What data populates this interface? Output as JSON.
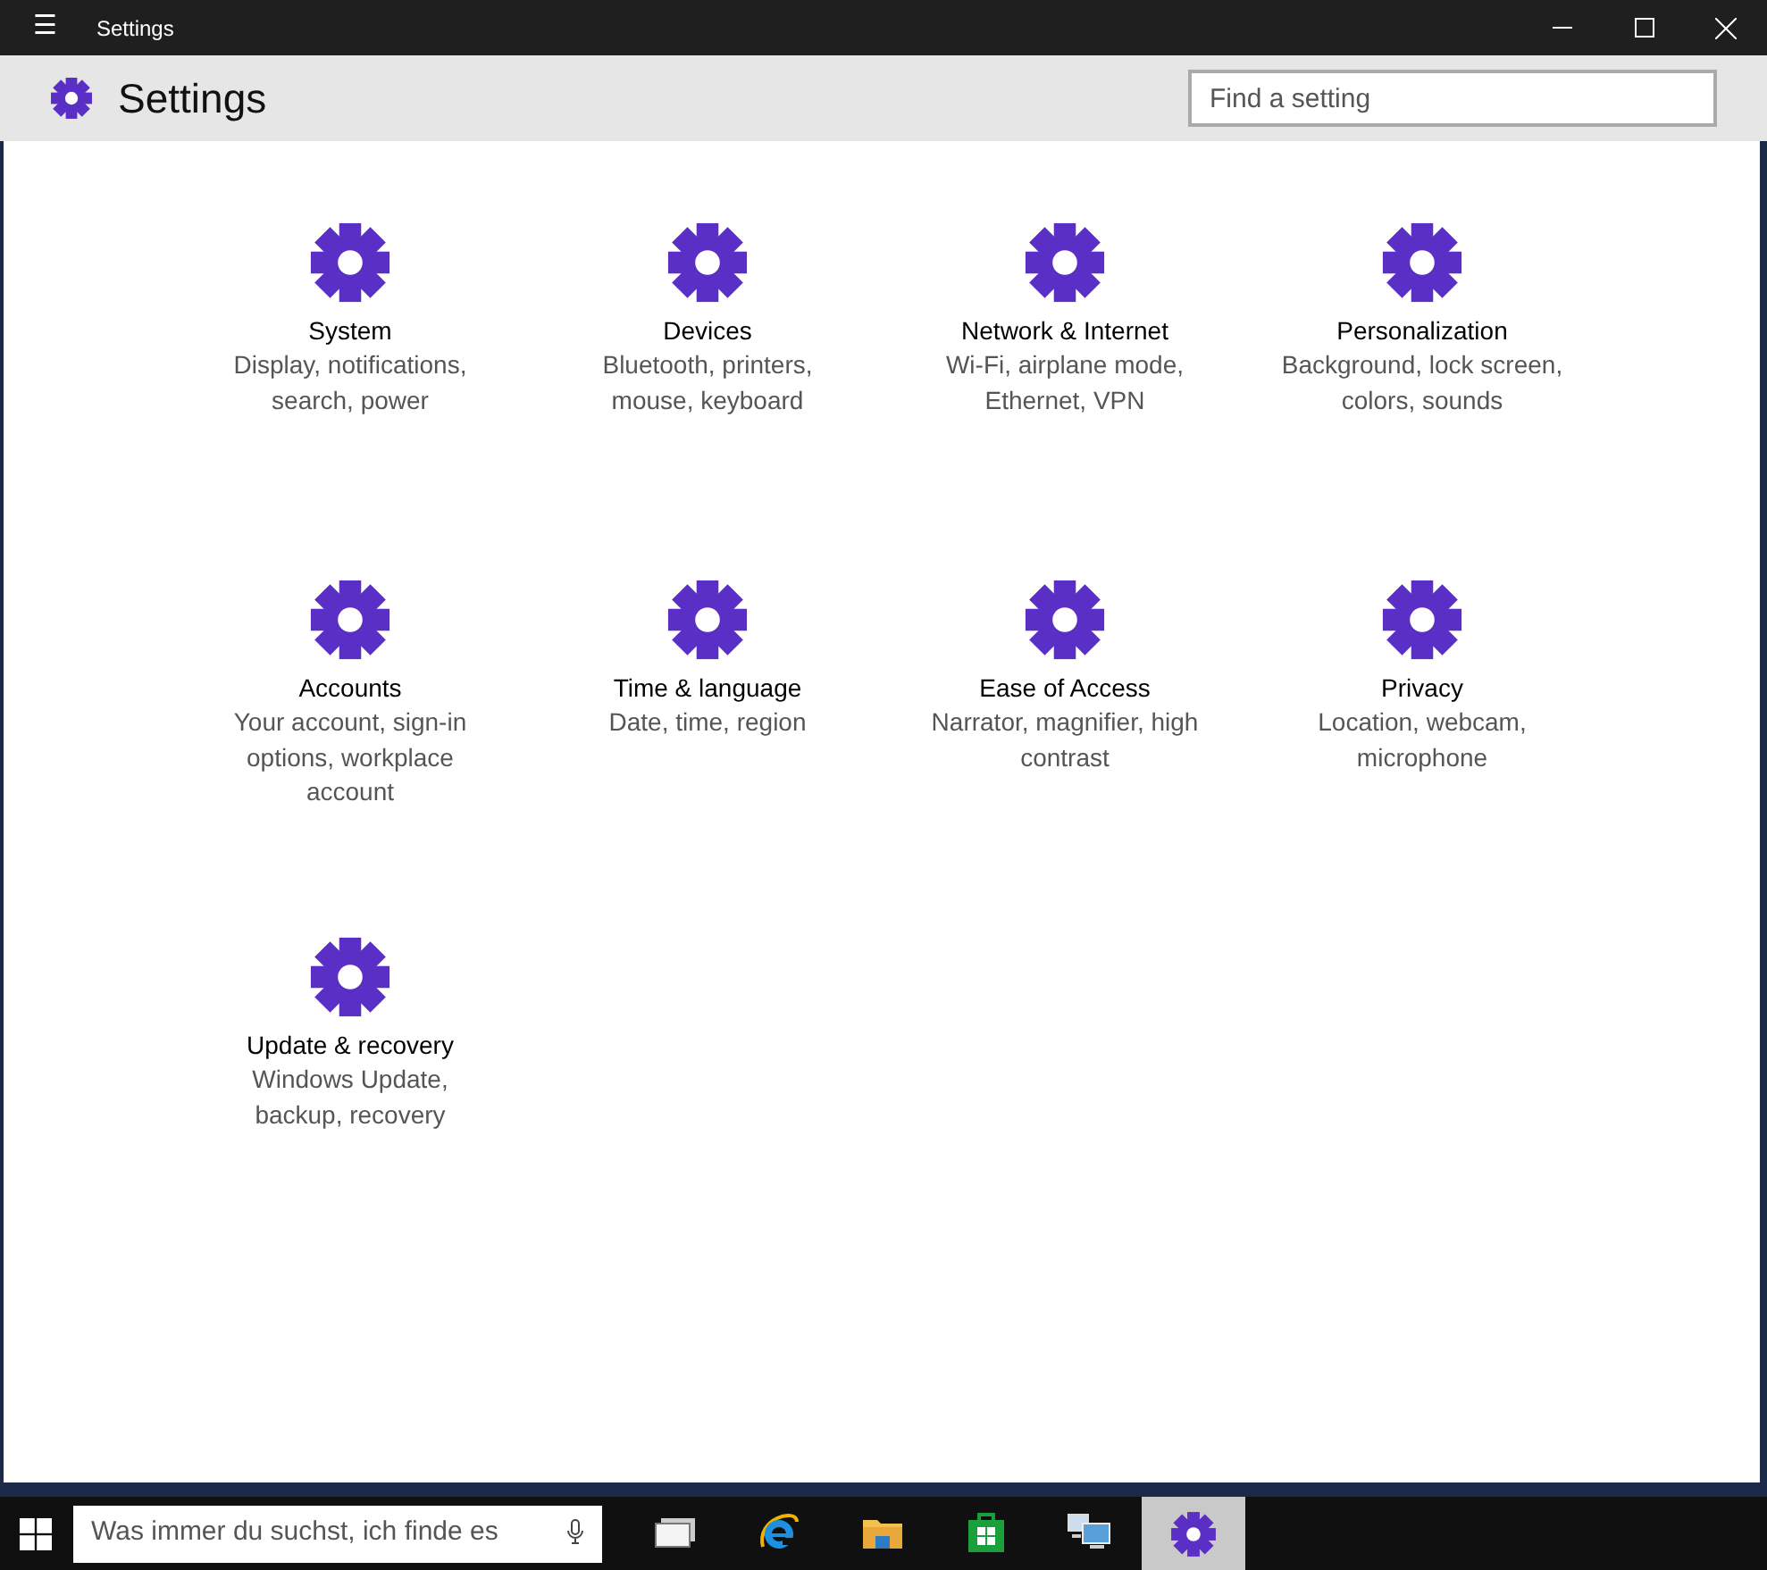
{
  "window": {
    "title": "Settings",
    "menu_glyph": "☰"
  },
  "header": {
    "title": "Settings",
    "search": {
      "placeholder": "Find a setting"
    }
  },
  "categories": [
    {
      "name": "System",
      "description": "Display, notifications, search, power"
    },
    {
      "name": "Devices",
      "description": "Bluetooth, printers, mouse, keyboard"
    },
    {
      "name": "Network & Internet",
      "description": "Wi-Fi, airplane mode, Ethernet, VPN"
    },
    {
      "name": "Personalization",
      "description": "Background, lock screen, colors, sounds"
    },
    {
      "name": "Accounts",
      "description": "Your account, sign-in options, workplace account"
    },
    {
      "name": "Time & language",
      "description": "Date, time, region"
    },
    {
      "name": "Ease of Access",
      "description": "Narrator, magnifier, high contrast"
    },
    {
      "name": "Privacy",
      "description": "Location, webcam, microphone"
    },
    {
      "name": "Update & recovery",
      "description": "Windows Update, backup, recovery"
    }
  ],
  "taskbar": {
    "search": {
      "placeholder": "Was immer du suchst, ich finde es"
    },
    "items": [
      {
        "kind": "task-view",
        "selected": false
      },
      {
        "kind": "browser",
        "selected": false
      },
      {
        "kind": "folder",
        "selected": false
      },
      {
        "kind": "store",
        "selected": false
      },
      {
        "kind": "network",
        "selected": false
      },
      {
        "kind": "settings",
        "selected": true
      }
    ]
  }
}
